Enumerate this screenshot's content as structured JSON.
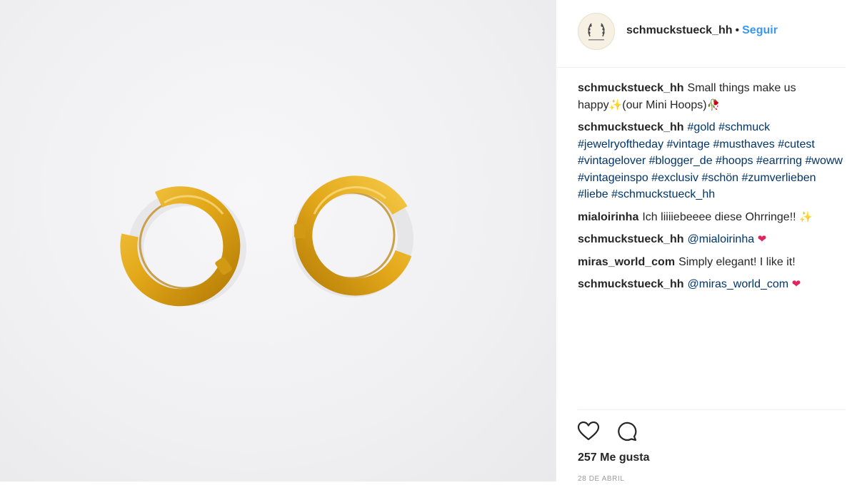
{
  "post": {
    "author": "schmuckstueck_hh",
    "separator": "•",
    "follow_label": "Seguir",
    "likes": "257 Me gusta",
    "date": "28 DE ABRIL"
  },
  "comments": [
    {
      "user": "schmuckstueck_hh",
      "parts": [
        {
          "t": "text",
          "v": "Small things make us happy"
        },
        {
          "t": "emoji",
          "v": "✨",
          "cls": "sparkle"
        },
        {
          "t": "text",
          "v": "(our Mini Hoops)"
        },
        {
          "t": "emoji",
          "v": "🥀"
        }
      ]
    },
    {
      "user": "schmuckstueck_hh",
      "parts": [
        {
          "t": "tag",
          "v": "#gold"
        },
        {
          "t": "text",
          "v": " "
        },
        {
          "t": "tag",
          "v": "#schmuck"
        },
        {
          "t": "text",
          "v": " "
        },
        {
          "t": "tag",
          "v": "#jewelryoftheday"
        },
        {
          "t": "text",
          "v": " "
        },
        {
          "t": "tag",
          "v": "#vintage"
        },
        {
          "t": "text",
          "v": " "
        },
        {
          "t": "tag",
          "v": "#musthaves"
        },
        {
          "t": "text",
          "v": " "
        },
        {
          "t": "tag",
          "v": "#cutest"
        },
        {
          "t": "text",
          "v": " "
        },
        {
          "t": "tag",
          "v": "#vintagelover"
        },
        {
          "t": "text",
          "v": " "
        },
        {
          "t": "tag",
          "v": "#blogger_de"
        },
        {
          "t": "text",
          "v": " "
        },
        {
          "t": "tag",
          "v": "#hoops"
        },
        {
          "t": "text",
          "v": " "
        },
        {
          "t": "tag",
          "v": "#earrring"
        },
        {
          "t": "text",
          "v": " "
        },
        {
          "t": "tag",
          "v": "#woww"
        },
        {
          "t": "text",
          "v": " "
        },
        {
          "t": "tag",
          "v": "#vintageinspo"
        },
        {
          "t": "text",
          "v": " "
        },
        {
          "t": "tag",
          "v": "#exclusiv"
        },
        {
          "t": "text",
          "v": " "
        },
        {
          "t": "tag",
          "v": "#schön"
        },
        {
          "t": "text",
          "v": " "
        },
        {
          "t": "tag",
          "v": "#zumverlieben"
        },
        {
          "t": "text",
          "v": " "
        },
        {
          "t": "tag",
          "v": "#liebe"
        },
        {
          "t": "text",
          "v": " "
        },
        {
          "t": "tag",
          "v": "#schmuckstueck_hh"
        }
      ]
    },
    {
      "user": "mialoirinha",
      "parts": [
        {
          "t": "text",
          "v": "Ich liiiiebeeee diese Ohrringe!! "
        },
        {
          "t": "emoji",
          "v": "✨",
          "cls": "sparkle"
        }
      ]
    },
    {
      "user": "schmuckstueck_hh",
      "parts": [
        {
          "t": "tag",
          "v": "@mialoirinha"
        },
        {
          "t": "text",
          "v": " "
        },
        {
          "t": "emoji",
          "v": "❤",
          "cls": "heart-emoji"
        }
      ]
    },
    {
      "user": "miras_world_com",
      "parts": [
        {
          "t": "text",
          "v": "Simply elegant! I like it!"
        }
      ]
    },
    {
      "user": "schmuckstueck_hh",
      "parts": [
        {
          "t": "tag",
          "v": "@miras_world_com"
        },
        {
          "t": "text",
          "v": " "
        },
        {
          "t": "emoji",
          "v": "❤",
          "cls": "heart-emoji"
        }
      ]
    }
  ],
  "colors": {
    "link": "#003569",
    "follow": "#3897f0",
    "gold": "#e0a91a",
    "gold_dark": "#b77f07",
    "background": "#f0f0f2"
  },
  "icons": {
    "like": "heart-outline-icon",
    "comment": "speech-bubble-icon"
  }
}
